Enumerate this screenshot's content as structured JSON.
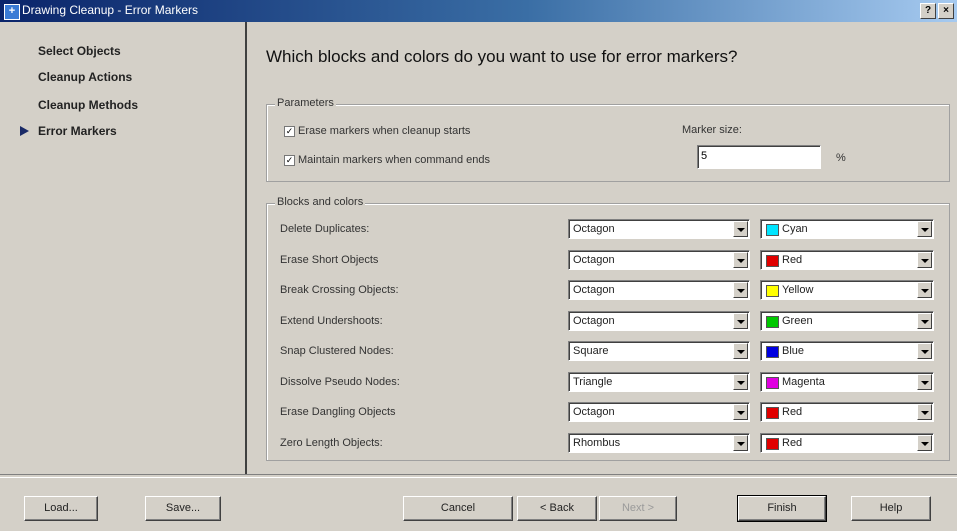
{
  "window": {
    "title": "Drawing Cleanup - Error Markers",
    "help_glyph": "?",
    "close_glyph": "×"
  },
  "sidebar": {
    "items": [
      {
        "label": "Select Objects"
      },
      {
        "label": "Cleanup Actions"
      },
      {
        "label": "Cleanup Methods"
      },
      {
        "label": "Error Markers",
        "current": true
      }
    ]
  },
  "main": {
    "heading": "Which blocks and colors do you want to use for error markers?",
    "parameters": {
      "legend": "Parameters",
      "erase_markers_label": "Erase markers when cleanup starts",
      "erase_markers_checked": true,
      "maintain_markers_label": "Maintain markers when command ends",
      "maintain_markers_checked": true,
      "check_glyph": "✓",
      "marker_size_label": "Marker size:",
      "marker_size_value": "5",
      "marker_size_unit": "%"
    },
    "blocks": {
      "legend": "Blocks and colors",
      "rows": [
        {
          "label": "Delete Duplicates:",
          "block": "Octagon",
          "color": "Cyan",
          "hex": "#00e5ff"
        },
        {
          "label": "Erase Short Objects",
          "block": "Octagon",
          "color": "Red",
          "hex": "#e00000"
        },
        {
          "label": "Break Crossing Objects:",
          "block": "Octagon",
          "color": "Yellow",
          "hex": "#ffff00"
        },
        {
          "label": "Extend Undershoots:",
          "block": "Octagon",
          "color": "Green",
          "hex": "#00c800"
        },
        {
          "label": "Snap Clustered Nodes:",
          "block": "Square",
          "color": "Blue",
          "hex": "#0000e0"
        },
        {
          "label": "Dissolve Pseudo Nodes:",
          "block": "Triangle",
          "color": "Magenta",
          "hex": "#e000e0"
        },
        {
          "label": "Erase Dangling Objects",
          "block": "Octagon",
          "color": "Red",
          "hex": "#e00000"
        },
        {
          "label": "Zero Length Objects:",
          "block": "Rhombus",
          "color": "Red",
          "hex": "#e00000"
        }
      ]
    }
  },
  "footer": {
    "load": "Load...",
    "save": "Save...",
    "cancel": "Cancel",
    "back": "< Back",
    "next": "Next >",
    "finish": "Finish",
    "help": "Help"
  }
}
